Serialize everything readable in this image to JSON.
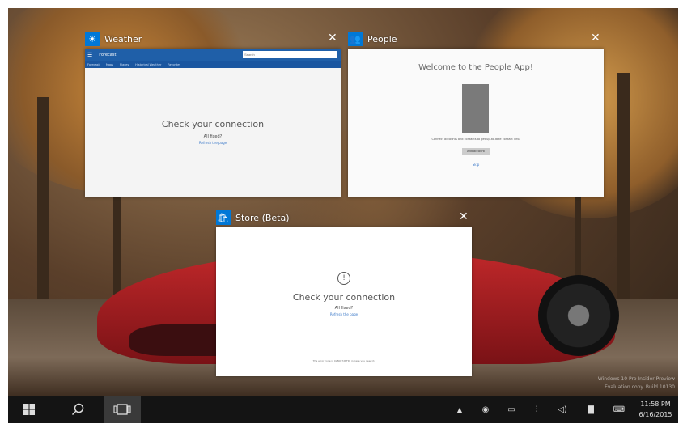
{
  "windows": {
    "weather": {
      "title": "Weather",
      "location": "Forecast",
      "search_placeholder": "Search",
      "tabs": [
        "Forecast",
        "Maps",
        "Places",
        "Historical Weather",
        "Favorites"
      ],
      "message": "Check your connection",
      "submessage": "All fixed?",
      "link": "Refresh the page"
    },
    "people": {
      "title": "People",
      "heading": "Welcome to the People App!",
      "description": "Connect accounts and contacts to get up-to-date contact info.",
      "button": "Add account",
      "link": "Skip"
    },
    "store": {
      "title": "Store (Beta)",
      "message": "Check your connection",
      "submessage": "All fixed?",
      "link": "Refresh the page",
      "footer": "The error code is 0x80072EFD, in case you need it."
    }
  },
  "taskbar": {
    "time": "11:58 PM",
    "date": "6/16/2015"
  },
  "watermark": {
    "line1": "Windows 10 Pro Insider Preview",
    "line2": "Evaluation copy. Build 10130"
  },
  "colors": {
    "accent": "#0078d7",
    "weather_bar": "#1f5fa8",
    "taskbar": "#141414"
  }
}
